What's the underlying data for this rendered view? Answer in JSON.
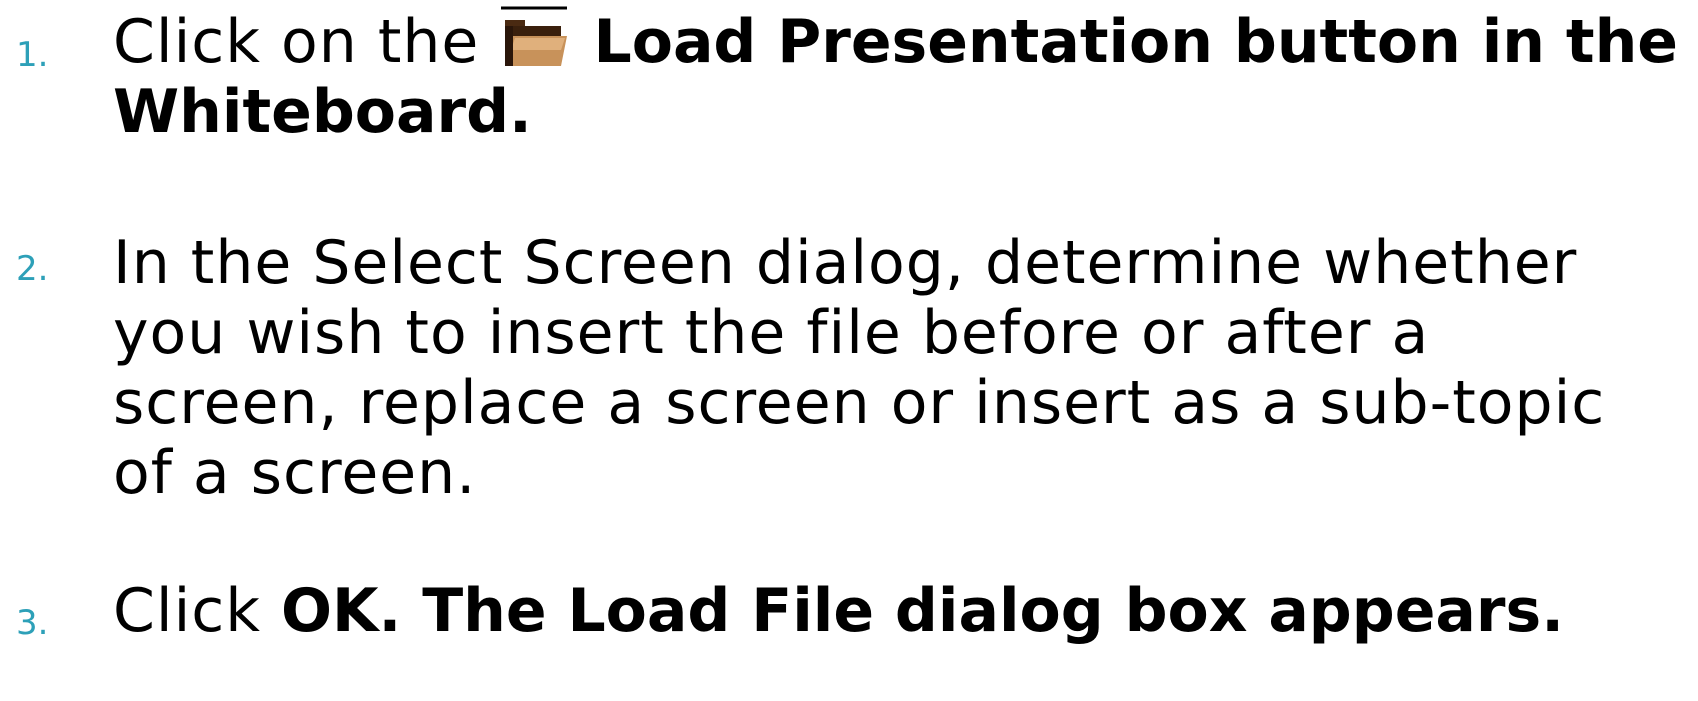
{
  "steps": [
    {
      "number": "1.",
      "pre": "Click on the",
      "icon": "load-presentation-folder-icon",
      "bold_line1": "Load Presentation button in the",
      "bold_line2": "Whiteboard."
    },
    {
      "number": "2.",
      "line1": "In the Select Screen dialog, determine whether",
      "line2": "you wish to insert the file before or after a",
      "line3": "screen, replace a screen or insert as a sub-topic",
      "line4": "of a screen."
    },
    {
      "number": "3.",
      "pre": "Click",
      "bold": "OK. The Load File dialog box appears."
    }
  ],
  "colors": {
    "number": "#2da0b8",
    "text": "#000000"
  }
}
